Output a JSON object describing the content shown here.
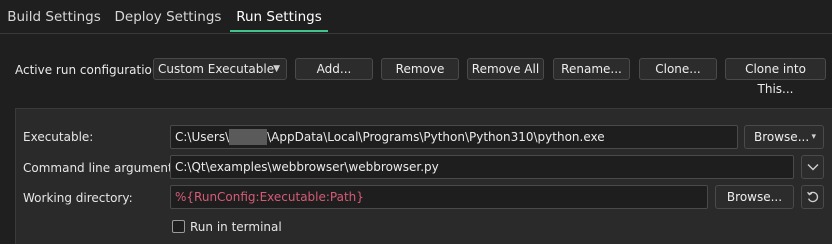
{
  "tabs": [
    {
      "label": "Build Settings"
    },
    {
      "label": "Deploy Settings"
    },
    {
      "label": "Run Settings",
      "active": true
    }
  ],
  "run_config": {
    "label": "Active run configuration:",
    "selected": "Custom Executable",
    "buttons": {
      "add": "Add...",
      "remove": "Remove",
      "remove_all": "Remove All",
      "rename": "Rename...",
      "clone": "Clone...",
      "clone_into": "Clone into This..."
    }
  },
  "form": {
    "executable": {
      "label": "Executable:",
      "value_prefix": "C:\\Users\\",
      "value_suffix": "\\AppData\\Local\\Programs\\Python\\Python310\\python.exe",
      "browse": "Browse..."
    },
    "arguments": {
      "label": "Command line arguments:",
      "value": "C:\\Qt\\examples\\webbrowser\\webbrowser.py"
    },
    "working_dir": {
      "label": "Working directory:",
      "value": "%{RunConfig:Executable:Path}",
      "browse": "Browse..."
    },
    "run_in_terminal": {
      "label": "Run in terminal",
      "checked": false
    }
  },
  "colors": {
    "accent": "#3fc48c",
    "placeholder_red": "#d55b78"
  }
}
